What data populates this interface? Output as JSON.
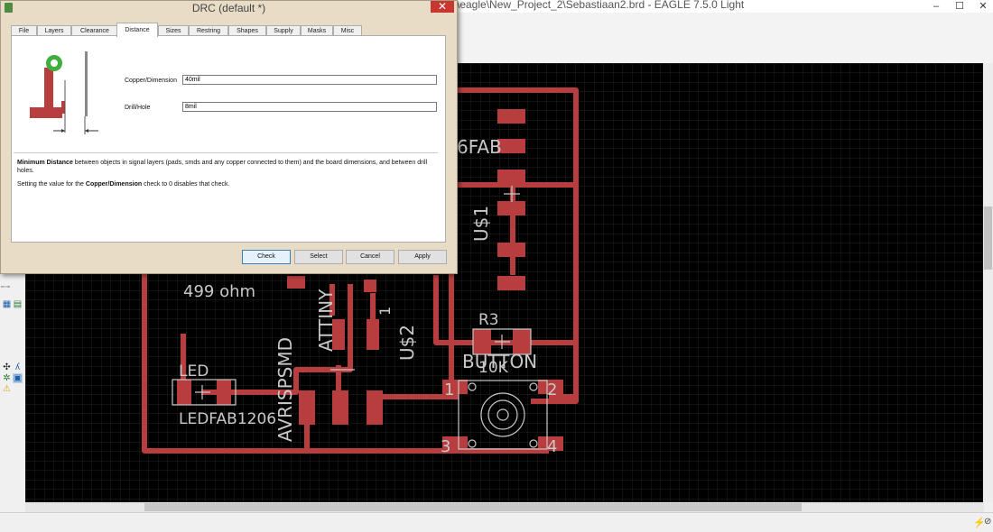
{
  "main_window": {
    "title": "s\\eagle\\New_Project_2\\Sebastiaan2.brd - EAGLE 7.5.0 Light",
    "controls": {
      "minimize": "–",
      "maximize": "☐",
      "close": "✕"
    }
  },
  "board": {
    "labels": {
      "fab": "6FAB",
      "us1": "U$1",
      "attiny": "ATTINY",
      "us2": "U$2",
      "pin1": "1",
      "avrispsmd": "AVRISPSMD",
      "r_value": "499 ohm",
      "led_name": "LED",
      "led_value": "LEDFAB1206",
      "r3_name": "R3",
      "r3_value": "10K",
      "button": "BUTTON",
      "btn_pin1": "1",
      "btn_pin2": "2",
      "btn_pin3": "3",
      "btn_pin4": "4"
    },
    "colors": {
      "background": "#000000",
      "grid": "#303030",
      "copper": "#b83d3f",
      "silk": "#c8c8c8"
    }
  },
  "dialog": {
    "title": "DRC (default *)",
    "close": "✕",
    "tabs": [
      "File",
      "Layers",
      "Clearance",
      "Distance",
      "Sizes",
      "Restring",
      "Shapes",
      "Supply",
      "Masks",
      "Misc"
    ],
    "active_tab": "Distance",
    "fields": {
      "copper_dimension": {
        "label": "Copper/Dimension",
        "value": "40mil"
      },
      "drill_hole": {
        "label": "Drill/Hole",
        "value": "8mil"
      }
    },
    "description": {
      "bold": "Minimum Distance",
      "text": " between objects in signal layers (pads, smds and any copper connected to them) and the board dimensions, and between drill holes.",
      "note_prefix": "Setting the value for the ",
      "note_bold": "Copper/Dimension",
      "note_suffix": " check to 0 disables that check."
    },
    "buttons": {
      "check": "Check",
      "select": "Select",
      "cancel": "Cancel",
      "apply": "Apply"
    }
  },
  "sidebar": {
    "icons": [
      "grid-icon",
      "layers-icon",
      "route-icon",
      "ratsnest-icon",
      "drc-icon",
      "warning-icon"
    ],
    "small_label": "en nb"
  }
}
